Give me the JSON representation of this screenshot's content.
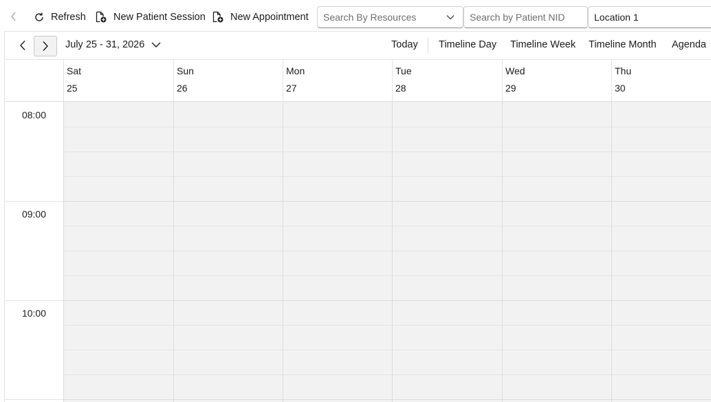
{
  "toolbar": {
    "back_icon": "chevron-left-icon",
    "refresh_label": "Refresh",
    "new_patient_session_label": "New Patient Session",
    "new_appointment_label": "New Appointment",
    "resources_placeholder": "Search By Resources",
    "patient_nid_placeholder": "Search by Patient NID",
    "location_value": "Location 1"
  },
  "calendar": {
    "date_range": "July 25 - 31, 2026",
    "views": {
      "today": "Today",
      "timeline_day": "Timeline Day",
      "timeline_week": "Timeline Week",
      "timeline_month": "Timeline Month",
      "agenda": "Agenda"
    },
    "days": [
      {
        "name": "Sat",
        "date": "25"
      },
      {
        "name": "Sun",
        "date": "26"
      },
      {
        "name": "Mon",
        "date": "27"
      },
      {
        "name": "Tue",
        "date": "28"
      },
      {
        "name": "Wed",
        "date": "29"
      },
      {
        "name": "Thu",
        "date": "30"
      }
    ],
    "times": [
      "08:00",
      "09:00",
      "10:00"
    ]
  },
  "colors": {
    "grid_background": "#f2f2f2",
    "grid_lines": "#dcdcdc",
    "text": "#1b1b1b"
  }
}
